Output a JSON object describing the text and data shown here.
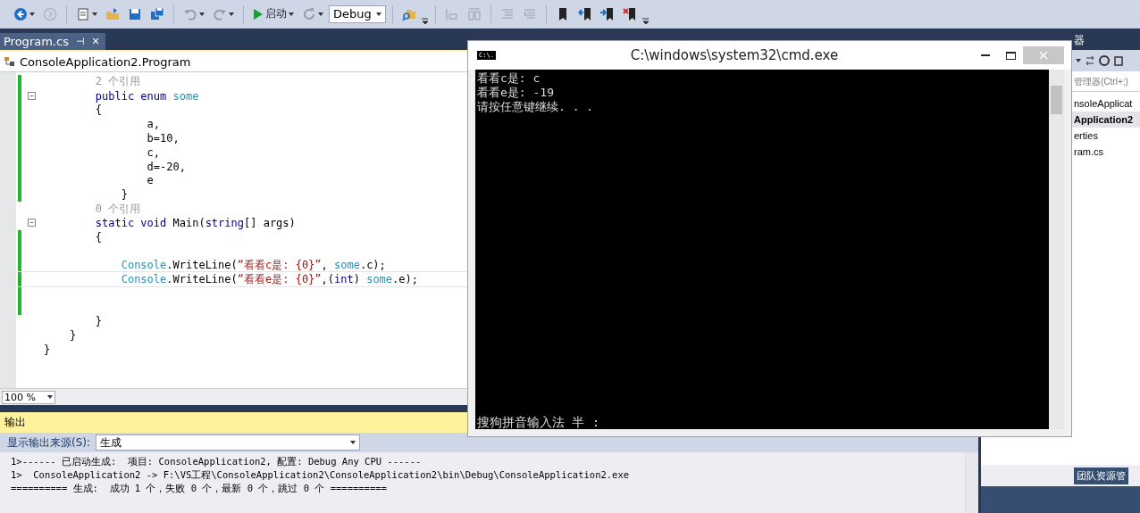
{
  "toolbar": {
    "items": [
      {
        "kind": "icon",
        "disabled": false,
        "menu": true
      },
      {
        "kind": "icon",
        "disabled": true,
        "menu": false
      },
      {
        "kind": "separator"
      },
      {
        "kind": "icon",
        "disabled": false,
        "menu": true
      },
      {
        "kind": "icon",
        "disabled": false,
        "menu": false
      },
      {
        "kind": "icon",
        "disabled": false,
        "menu": false
      },
      {
        "kind": "icon",
        "disabled": false,
        "menu": false
      },
      {
        "kind": "separator"
      },
      {
        "kind": "icon",
        "disabled": true,
        "menu": true
      },
      {
        "kind": "icon",
        "disabled": true,
        "menu": true
      },
      {
        "kind": "separator"
      },
      {
        "kind": "run",
        "label": "启动",
        "menu": true
      },
      {
        "kind": "icon",
        "disabled": true,
        "menu": true
      },
      {
        "kind": "combo",
        "value": "Debug"
      },
      {
        "kind": "separator"
      },
      {
        "kind": "icon",
        "disabled": false,
        "menu": false
      },
      {
        "kind": "overflow"
      },
      {
        "kind": "separator"
      },
      {
        "kind": "icon",
        "disabled": true,
        "menu": false
      },
      {
        "kind": "icon",
        "disabled": true,
        "menu": false
      },
      {
        "kind": "separator"
      },
      {
        "kind": "icon",
        "disabled": true,
        "menu": false
      },
      {
        "kind": "icon",
        "disabled": true,
        "menu": false
      },
      {
        "kind": "separator"
      },
      {
        "kind": "icon",
        "disabled": false,
        "menu": false
      },
      {
        "kind": "icon",
        "disabled": false,
        "menu": false
      },
      {
        "kind": "icon",
        "disabled": false,
        "menu": false
      },
      {
        "kind": "icon",
        "disabled": false,
        "menu": false
      },
      {
        "kind": "overflow"
      }
    ]
  },
  "editor": {
    "tabs": [
      {
        "label": "Program.cs",
        "selected": true,
        "pin": "⊣",
        "close": "✕"
      }
    ],
    "navigation": "ConsoleApplication2.Program",
    "lines": [
      {
        "changed": true,
        "fold": false,
        "current": false,
        "tokens": [
          {
            "kind": "lens",
            "text": "        2 个引用"
          }
        ]
      },
      {
        "changed": true,
        "fold": true,
        "current": false,
        "tokens": [
          {
            "kind": "keyword",
            "text": "        public enum"
          },
          {
            "kind": "type",
            "text": " some"
          }
        ]
      },
      {
        "changed": true,
        "fold": false,
        "current": false,
        "tokens": [
          {
            "kind": "plain",
            "text": "        {"
          }
        ]
      },
      {
        "changed": true,
        "fold": false,
        "current": false,
        "tokens": [
          {
            "kind": "plain",
            "text": "                a,"
          }
        ]
      },
      {
        "changed": true,
        "fold": false,
        "current": false,
        "tokens": [
          {
            "kind": "plain",
            "text": "                b=10,"
          }
        ]
      },
      {
        "changed": true,
        "fold": false,
        "current": false,
        "tokens": [
          {
            "kind": "plain",
            "text": "                c,"
          }
        ]
      },
      {
        "changed": true,
        "fold": false,
        "current": false,
        "tokens": [
          {
            "kind": "plain",
            "text": "                d=-20,"
          }
        ]
      },
      {
        "changed": true,
        "fold": false,
        "current": false,
        "tokens": [
          {
            "kind": "plain",
            "text": "                e"
          }
        ]
      },
      {
        "changed": true,
        "fold": false,
        "current": false,
        "tokens": [
          {
            "kind": "plain",
            "text": "            }"
          }
        ]
      },
      {
        "changed": false,
        "fold": false,
        "current": false,
        "tokens": [
          {
            "kind": "lens",
            "text": "        0 个引用"
          }
        ]
      },
      {
        "changed": false,
        "fold": true,
        "current": false,
        "tokens": [
          {
            "kind": "keyword",
            "text": "        static void"
          },
          {
            "kind": "plain",
            "text": " Main("
          },
          {
            "kind": "keyword",
            "text": "string"
          },
          {
            "kind": "plain",
            "text": "[] args)"
          }
        ]
      },
      {
        "changed": true,
        "fold": false,
        "current": false,
        "tokens": [
          {
            "kind": "plain",
            "text": "        {"
          }
        ]
      },
      {
        "changed": true,
        "fold": false,
        "current": false
      },
      {
        "changed": true,
        "fold": false,
        "current": false,
        "tokens": [
          {
            "kind": "type",
            "text": "            Console"
          },
          {
            "kind": "plain",
            "text": ".WriteLine("
          },
          {
            "kind": "string",
            "text": "“看看c是: {0}”"
          },
          {
            "kind": "plain",
            "text": ", "
          },
          {
            "kind": "type",
            "text": "some"
          },
          {
            "kind": "plain",
            "text": ".c);"
          }
        ]
      },
      {
        "changed": true,
        "fold": false,
        "current": true,
        "tokens": [
          {
            "kind": "type",
            "text": "            Console"
          },
          {
            "kind": "plain",
            "text": ".WriteLine("
          },
          {
            "kind": "string",
            "text": "“看看e是: {0}”"
          },
          {
            "kind": "plain",
            "text": ",("
          },
          {
            "kind": "keyword",
            "text": "int"
          },
          {
            "kind": "plain",
            "text": ") "
          },
          {
            "kind": "type",
            "text": "some"
          },
          {
            "kind": "plain",
            "text": ".e);"
          }
        ]
      },
      {
        "changed": true,
        "fold": false,
        "current": false
      },
      {
        "changed": true,
        "fold": false,
        "current": false
      },
      {
        "changed": false,
        "fold": false,
        "current": false,
        "tokens": [
          {
            "kind": "plain",
            "text": "        }"
          }
        ]
      },
      {
        "changed": false,
        "fold": false,
        "current": false,
        "tokens": [
          {
            "kind": "plain",
            "text": "    }"
          }
        ]
      },
      {
        "changed": false,
        "fold": false,
        "current": false,
        "tokens": [
          {
            "kind": "plain",
            "text": "}"
          }
        ]
      }
    ],
    "zoom": "100 %"
  },
  "output": {
    "title": "输出",
    "source_label": "显示输出来源(S):",
    "source": "生成",
    "lines": [
      "1>------ 已启动生成:  项目: ConsoleApplication2, 配置: Debug Any CPU ------",
      "1>  ConsoleApplication2 -> F:\\VS工程\\ConsoleApplication2\\ConsoleApplication2\\bin\\Debug\\ConsoleApplication2.exe",
      "========== 生成:  成功 1 个，失败 0 个，最新 0 个，跳过 0 个 =========="
    ]
  },
  "solution_explorer": {
    "title": "器",
    "search": {
      "placeholder": "管理器(Ctrl+;)"
    },
    "tree": [
      {
        "label": "nsoleApplicat",
        "kind": "solution",
        "selected": false,
        "children": [
          {
            "label": "Application2",
            "kind": "project",
            "selected": true,
            "children": [
              {
                "label": "erties",
                "kind": "item",
                "selected": false
              },
              {
                "label": "ram.cs",
                "kind": "item",
                "selected": false
              }
            ]
          }
        ]
      }
    ],
    "bottom_tab": "团队资源管"
  },
  "console": {
    "title": "C:\\windows\\system32\\cmd.exe",
    "icon_text": "C:\\.",
    "lines": [
      "看看c是: c",
      "看看e是: -19",
      "请按任意键继续. . ."
    ],
    "ime_status": "搜狗拼音输入法 半 :"
  }
}
